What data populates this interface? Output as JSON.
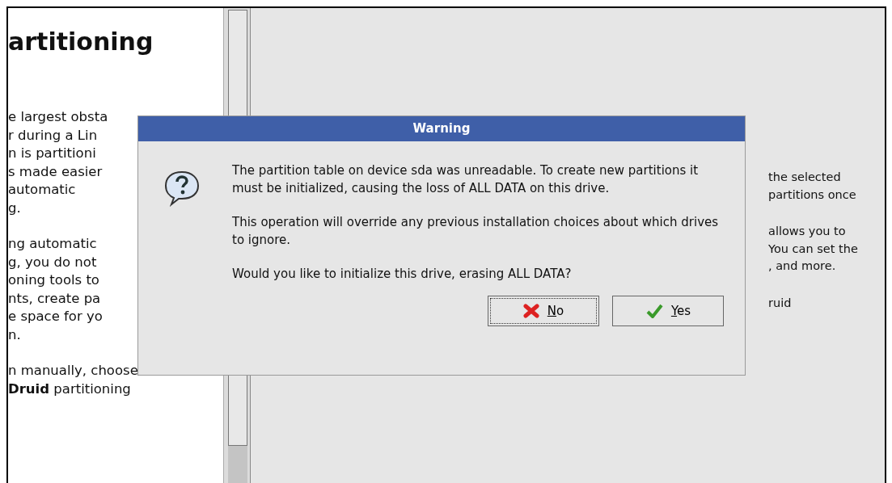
{
  "help_panel": {
    "title": "artitioning",
    "paragraphs": [
      [
        "e largest obsta",
        "r during a Lin",
        "n is partitioni",
        "s made easier",
        "automatic",
        "g."
      ],
      [
        "ng automatic",
        "g, you do not",
        "oning tools to",
        "nts, create pa",
        "e space for yo",
        "n."
      ],
      [
        "n manually, choose",
        "**Druid** partitioning"
      ]
    ]
  },
  "main_panel": {
    "paragraphs": [
      [
        "the selected",
        "partitions once"
      ],
      [
        "allows you to",
        "You can set the",
        ", and more."
      ],
      [
        "ruid"
      ]
    ]
  },
  "dialog": {
    "title": "Warning",
    "paragraphs": [
      "The partition table on device sda was unreadable. To create new partitions it must be initialized, causing the loss of ALL DATA on this drive.",
      "This operation will override any previous installation choices about which drives to ignore.",
      "Would you like to initialize this drive, erasing ALL DATA?"
    ],
    "buttons": [
      {
        "kind": "cancel",
        "label": "No",
        "underline_first": true,
        "focused": true
      },
      {
        "kind": "ok",
        "label": "Yes",
        "underline_first": true,
        "focused": false
      }
    ]
  }
}
